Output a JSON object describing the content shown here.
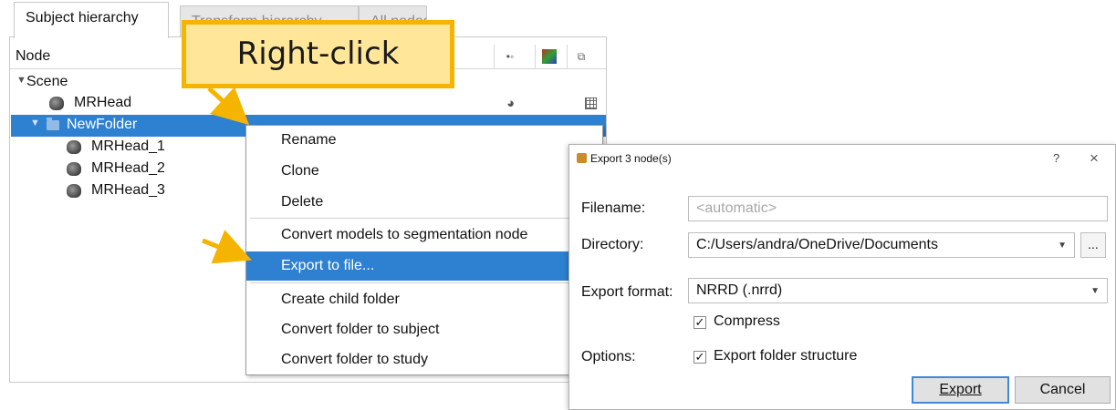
{
  "tabs": [
    {
      "label": "Subject hierarchy"
    },
    {
      "label": "Transform hierarchy"
    },
    {
      "label": "All nodes"
    }
  ],
  "tree": {
    "header": {
      "node_label": "Node",
      "col_icons": [
        "visibility-icon",
        "color-icon",
        "transform-icon"
      ]
    },
    "rows": [
      {
        "label": "Scene",
        "icon": "caret-down-icon"
      },
      {
        "label": "MRHead",
        "icon": "volume-icon"
      },
      {
        "label": "NewFolder",
        "icon": "folder-icon",
        "selected": true
      },
      {
        "label": "MRHead_1",
        "icon": "volume-icon"
      },
      {
        "label": "MRHead_2",
        "icon": "volume-icon"
      },
      {
        "label": "MRHead_3",
        "icon": "volume-icon"
      }
    ]
  },
  "callout": {
    "text": "Right-click",
    "fill": "#ffe699",
    "border": "#f5b400"
  },
  "context_menu": {
    "items": [
      {
        "label": "Rename"
      },
      {
        "label": "Clone"
      },
      {
        "label": "Delete"
      },
      {
        "label": "Convert models to segmentation node"
      },
      {
        "label": "Export to file...",
        "highlighted": true
      },
      {
        "label": "Create child folder"
      },
      {
        "label": "Convert folder to subject"
      },
      {
        "label": "Convert folder to study"
      }
    ]
  },
  "dialog": {
    "title": "Export 3 node(s)",
    "help": "?",
    "close": "×",
    "filename_label": "Filename:",
    "filename_placeholder": "<automatic>",
    "directory_label": "Directory:",
    "directory_value": "C:/Users/andra/OneDrive/Documents",
    "browse_label": "...",
    "format_label": "Export format:",
    "format_value": "NRRD (.nrrd)",
    "compress_label": "Compress",
    "compress_checked": true,
    "options_label": "Options:",
    "folder_structure_label": "Export folder structure",
    "folder_structure_checked": true,
    "export_button": "Export",
    "cancel_button": "Cancel"
  },
  "colors": {
    "selection": "#2e80d0",
    "arrow": "#f5b400"
  }
}
